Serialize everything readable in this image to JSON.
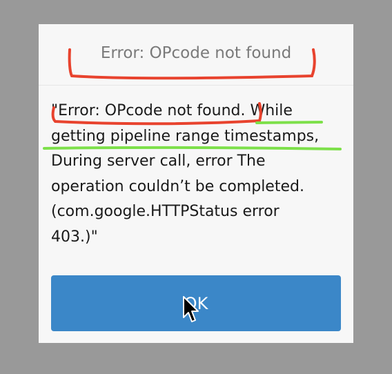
{
  "dialog": {
    "title": "Error: OPcode not found",
    "message_lines": [
      "\"Error: OPcode not found. While",
      "getting pipeline range timestamps,",
      "During server call, error The",
      "operation couldn’t be completed.",
      "(com.google.HTTPStatus error",
      "403.)\""
    ],
    "ok_label": "OK"
  },
  "colors": {
    "backdrop": "#999999",
    "dialog_background": "#f7f7f7",
    "button": "#3b87c8",
    "annotation_red": "#e8432e",
    "annotation_green": "#7de04a"
  },
  "icons": {
    "cursor": "mouse-pointer-arrow-icon"
  }
}
